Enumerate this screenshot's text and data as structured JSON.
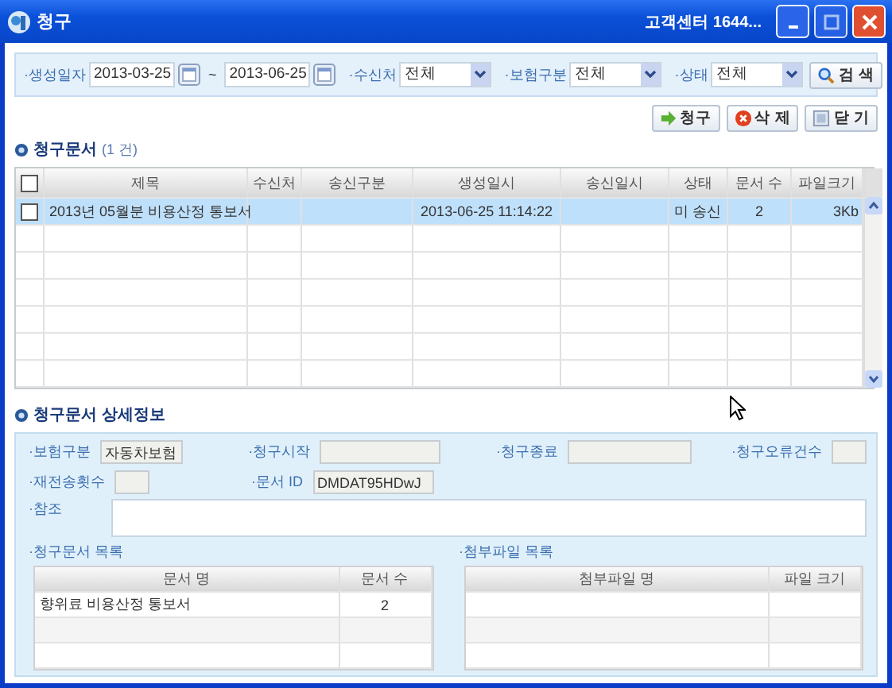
{
  "window": {
    "title": "청구",
    "help": "고객센터 1644..."
  },
  "search": {
    "fields": [
      {
        "kind": "daterange",
        "label": "·생성일자",
        "from": "2013-03-25",
        "sep": "~",
        "to": "2013-06-25"
      },
      {
        "kind": "select",
        "label": "·수신처",
        "value": "전체"
      },
      {
        "kind": "select",
        "label": "·보험구분",
        "value": "전체"
      },
      {
        "kind": "select",
        "label": "·상태",
        "value": "전체"
      }
    ],
    "button": "검 색"
  },
  "actions": [
    {
      "kind": "send",
      "label": "청구"
    },
    {
      "kind": "delete",
      "label": "삭 제"
    },
    {
      "kind": "close",
      "label": "닫 기"
    }
  ],
  "documents": {
    "title": "청구문서",
    "count": "(1 건)",
    "select_all_checked": false,
    "columns": [
      "제목",
      "수신처",
      "송신구분",
      "생성일시",
      "송신일시",
      "상태",
      "문서 수",
      "파일크기"
    ],
    "rows": [
      {
        "checked": false,
        "selected": true,
        "cells": [
          "2013년 05월분 비용산정 통보서",
          "",
          "",
          "2013-06-25 11:14:22",
          "",
          "미 송신",
          "2",
          "3Kb"
        ]
      }
    ]
  },
  "details": {
    "title": "청구문서 상세정보",
    "fields": [
      {
        "label": "·보험구분",
        "value": "자동차보험"
      },
      {
        "label": "·청구시작"
      },
      {
        "label": "·청구종료"
      },
      {
        "label": "·청구오류건수"
      },
      {
        "label": "·재전송횟수"
      },
      {
        "label": "·문서 ID",
        "value": "DMDAT95HDwJ"
      }
    ],
    "note_label": "·참조",
    "doc_list": {
      "title": "·청구문서 목록",
      "columns": [
        "문서 명",
        "문서 수"
      ],
      "rows": [
        [
          "향위료 비용산정 통보서",
          "2"
        ]
      ]
    },
    "file_list": {
      "title": "·첨부파일 목록",
      "columns": [
        "첨부파일 명",
        "파일 크기"
      ]
    }
  }
}
